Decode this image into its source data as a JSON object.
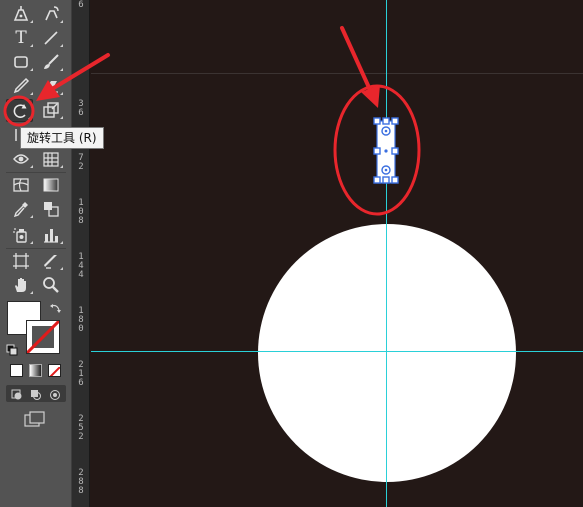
{
  "toolbar": {
    "tools": [
      {
        "name": "pen-tool-icon",
        "interactable": true
      },
      {
        "name": "curvature-pen-icon",
        "interactable": true
      },
      {
        "name": "type-tool-icon",
        "label": "T",
        "interactable": true
      },
      {
        "name": "line-segment-tool-icon",
        "interactable": true
      },
      {
        "name": "rectangle-tool-icon",
        "interactable": true
      },
      {
        "name": "paintbrush-tool-icon",
        "interactable": true
      },
      {
        "name": "pencil-tool-icon",
        "interactable": true
      },
      {
        "name": "eraser-tool-icon",
        "interactable": true
      },
      {
        "name": "rotate-tool-icon",
        "interactable": true,
        "selected": true
      },
      {
        "name": "scale-tool-icon",
        "interactable": true
      },
      {
        "name": "free-transform-tool-icon",
        "interactable": true
      },
      {
        "name": "shape-builder-tool-icon",
        "interactable": true
      },
      {
        "name": "perspective-grid-tool-icon",
        "interactable": true
      },
      {
        "name": "mesh-tool-icon",
        "interactable": true
      },
      {
        "name": "gradient-tool-icon",
        "interactable": true
      },
      {
        "name": "eyedropper-tool-icon",
        "interactable": true
      },
      {
        "name": "blend-tool-icon",
        "interactable": true
      },
      {
        "name": "symbol-sprayer-tool-icon",
        "interactable": true
      },
      {
        "name": "column-graph-tool-icon",
        "interactable": true
      },
      {
        "name": "artboard-tool-icon",
        "interactable": true
      },
      {
        "name": "slice-tool-icon",
        "interactable": true
      },
      {
        "name": "hand-tool-icon",
        "interactable": true
      },
      {
        "name": "zoom-tool-icon",
        "interactable": true
      }
    ],
    "fill_color": "#ffffff",
    "stroke_color": "none"
  },
  "tooltip": {
    "text": "旋转工具 (R)"
  },
  "ruler": {
    "labels": [
      "6",
      "3\n6",
      "7\n2",
      "1\n0\n8",
      "1\n4\n4",
      "1\n8\n0",
      "2\n1\n6",
      "2\n5\n2",
      "2\n8\n8"
    ]
  },
  "canvas": {
    "background": "#231816",
    "guide_color": "#2ad0d8",
    "circle_fill": "#ffffff",
    "annotation_color": "#e8262c",
    "selection_color": "#3b6fe0"
  }
}
